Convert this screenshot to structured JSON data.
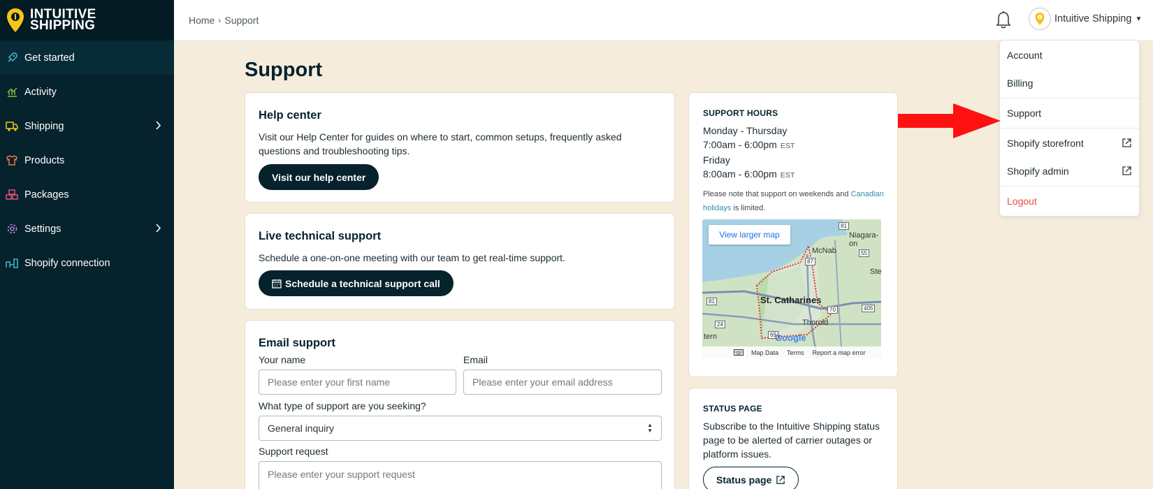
{
  "brand": {
    "line1": "INTUITIVE",
    "line2": "SHIPPING",
    "accent": "#f5c518"
  },
  "sidebar": {
    "items": [
      {
        "label": "Get started",
        "icon": "rocket-icon"
      },
      {
        "label": "Activity",
        "icon": "chart-icon"
      },
      {
        "label": "Shipping",
        "icon": "truck-icon"
      },
      {
        "label": "Products",
        "icon": "shirt-icon"
      },
      {
        "label": "Packages",
        "icon": "boxes-icon"
      },
      {
        "label": "Settings",
        "icon": "gear-icon"
      },
      {
        "label": "Shopify connection",
        "icon": "connection-icon"
      }
    ]
  },
  "header": {
    "breadcrumb": {
      "home": "Home",
      "current": "Support"
    },
    "user_name": "Intuitive Shipping"
  },
  "user_menu": {
    "account": "Account",
    "billing": "Billing",
    "support": "Support",
    "shopify_storefront": "Shopify storefront",
    "shopify_admin": "Shopify admin",
    "logout": "Logout"
  },
  "page": {
    "title": "Support"
  },
  "help_center": {
    "title": "Help center",
    "text": "Visit our Help Center for guides on where to start, common setups, frequently asked questions and troubleshooting tips.",
    "button": "Visit our help center"
  },
  "live_support": {
    "title": "Live technical support",
    "text": "Schedule a one-on-one meeting with our team to get real-time support.",
    "button": "Schedule a technical support call"
  },
  "email_support": {
    "title": "Email support",
    "name_label": "Your name",
    "name_placeholder": "Please enter your first name",
    "email_label": "Email",
    "email_placeholder": "Please enter your email address",
    "type_label": "What type of support are you seeking?",
    "type_value": "General inquiry",
    "request_label": "Support request",
    "request_placeholder": "Please enter your support request"
  },
  "support_hours": {
    "title": "SUPPORT HOURS",
    "days1": "Monday - Thursday",
    "time1": "7:00am - 6:00pm",
    "tz1": "EST",
    "days2": "Friday",
    "time2": "8:00am - 6:00pm",
    "tz2": "EST",
    "note_before": "Please note that support on weekends and",
    "note_link": "Canadian holidays",
    "note_after": "is limited.",
    "map": {
      "button": "View larger map",
      "city": "St. Catharines",
      "places": [
        "Niagara-on",
        "McNab",
        "Ste",
        "Thorold",
        "tern"
      ],
      "routes": [
        "87",
        "55",
        "81",
        "70",
        "405",
        "24",
        "69",
        "81"
      ],
      "google": "Google",
      "footer": [
        "Map Data",
        "Terms",
        "Report a map error"
      ]
    }
  },
  "status_page": {
    "title": "STATUS PAGE",
    "text": "Subscribe to the Intuitive Shipping status page to be alerted of carrier outages or platform issues.",
    "button": "Status page"
  }
}
